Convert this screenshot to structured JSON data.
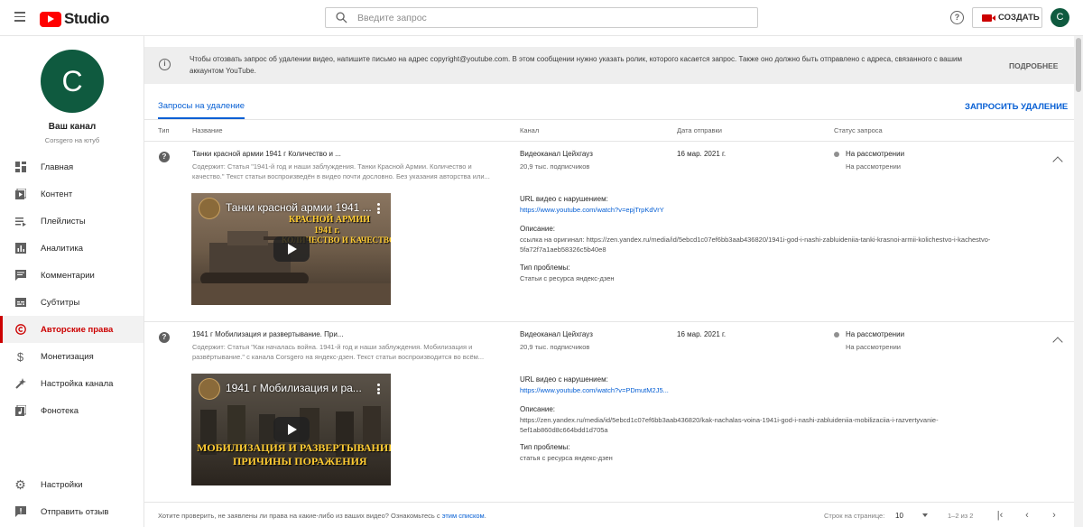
{
  "header": {
    "logo_text": "Studio",
    "search_placeholder": "Введите запрос",
    "create_label": "СОЗДАТЬ",
    "avatar_letter": "С",
    "help_glyph": "?"
  },
  "sidebar": {
    "avatar_letter": "С",
    "channel_title": "Ваш канал",
    "channel_subtitle": "Corsgero на ютуб",
    "items": [
      {
        "label": "Главная",
        "icon": "dashboard-icon"
      },
      {
        "label": "Контент",
        "icon": "content-icon"
      },
      {
        "label": "Плейлисты",
        "icon": "playlists-icon"
      },
      {
        "label": "Аналитика",
        "icon": "analytics-icon"
      },
      {
        "label": "Комментарии",
        "icon": "comments-icon"
      },
      {
        "label": "Субтитры",
        "icon": "subtitles-icon"
      },
      {
        "label": "Авторские права",
        "icon": "copyright-icon",
        "active": true
      },
      {
        "label": "Монетизация",
        "icon": "monetization-icon"
      },
      {
        "label": "Настройка канала",
        "icon": "customization-icon"
      },
      {
        "label": "Фонотека",
        "icon": "audio-library-icon"
      }
    ],
    "bottom_items": [
      {
        "label": "Настройки",
        "icon": "settings-icon"
      },
      {
        "label": "Отправить отзыв",
        "icon": "feedback-icon"
      }
    ]
  },
  "banner": {
    "text": "Чтобы отозвать запрос об удалении видео, напишите письмо на адрес copyright@youtube.com. В этом сообщении нужно указать ролик, которого касается запрос. Также оно должно быть отправлено с адреса, связанного с вашим аккаунтом YouTube.",
    "more_label": "ПОДРОБНЕЕ"
  },
  "tabs": {
    "active_tab": "Запросы на удаление",
    "request_button": "ЗАПРОСИТЬ УДАЛЕНИЕ"
  },
  "table": {
    "headers": {
      "type": "Тип",
      "name": "Название",
      "channel": "Канал",
      "date": "Дата отправки",
      "status": "Статус запроса"
    },
    "url_label": "URL видео с нарушением:",
    "desc_label": "Описание:",
    "problem_label": "Тип проблемы:",
    "rows": [
      {
        "title": "Танки красной армии 1941 г Количество и ...",
        "description": "Содержит: Статья \"1941-й год и наши заблуждения. Танки Красной Армии. Количество и качество.\" Текст статьи воспроизведён в видео почти дословно. Без указания авторства или...",
        "video_title": "Танки красной армии 1941 ...",
        "overlay_lines": [
          "КРАСНОЙ АРМИИ",
          "1941 г.",
          "КОЛИЧЕСТВО И КАЧЕСТВО"
        ],
        "channel": "Видеоканал Цейхгауз",
        "subscribers": "20,9 тыс. подписчиков",
        "date": "16 мар. 2021 г.",
        "status": "На рассмотрении",
        "status_sub": "На рассмотрении",
        "url": "https://www.youtube.com/watch?v=epjTrpKdVrY",
        "desc_value": "ссылка на оригинал: https://zen.yandex.ru/media/id/5ebcd1c07ef6bb3aab436820/1941i-god-i-nashi-zabluideniia-tanki-krasnoi-armii-kolichestvo-i-kachestvo-5fa72f7a1aeb58326c5b40e8",
        "problem": "Статьи с ресурса яндекс-дзен"
      },
      {
        "title": "1941 г Мобилизация и развертывание. При...",
        "description": "Содержит: Статья \"Как началась война. 1941-й год и наши заблуждения. Мобилизация и развёртывание.\" с канала Corsgero на яндекс-дзен. Текст статьи воспроизводится во всём...",
        "video_title": "1941 г Мобилизация и ра...",
        "overlay_lines": [
          "МОБИЛИЗАЦИЯ И РАЗВЕРТЫВАНИЕ",
          "ПРИЧИНЫ ПОРАЖЕНИЯ"
        ],
        "channel": "Видеоканал Цейхгауз",
        "subscribers": "20,9 тыс. подписчиков",
        "date": "16 мар. 2021 г.",
        "status": "На рассмотрении",
        "status_sub": "На рассмотрении",
        "url": "https://www.youtube.com/watch?v=PDmutM2J5...",
        "desc_value": "https://zen.yandex.ru/media/id/5ebcd1c07ef6bb3aab436820/kak-nachalas-voina-1941i-god-i-nashi-zabluideniia-mobilizaciia-i-razvertyvanie-5ef1ab860d8c664bdd1d705a",
        "problem": "статья с ресурса яндекс-дзен"
      }
    ]
  },
  "footer": {
    "text": "Хотите проверить, не заявлены ли права на какие-либо из ваших видео? Ознакомьтесь с",
    "link": "этим списком",
    "rows_label": "Строк на странице:",
    "rows_value": "10",
    "range": "1–2 из 2"
  }
}
